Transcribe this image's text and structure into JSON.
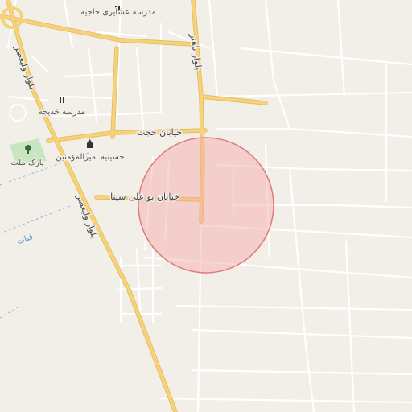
{
  "map": {
    "roads": {
      "vali_asr": "بلوار ولیعصر",
      "bahonar": "بلوار باهنر",
      "hojjat": "خیابان حجت",
      "bu_ali_sina": "خیابان بو علی سینا"
    },
    "pois": {
      "school_hajiyeh": "مدرسه عشایری حاجیه",
      "school_khadijeh": "مدرسه خدیجه",
      "hosseiniyeh": "حسینیه امیرالمؤمنین",
      "park": "پارک ملت"
    },
    "water": {
      "qanat": "قنات"
    },
    "colors": {
      "background": "#f2efe9",
      "primary_road": "#f6d37a",
      "minor_road": "#ffffff",
      "park": "#c8e6c2",
      "highlight_fill": "#f4a6a6",
      "highlight_stroke": "#e07b7b",
      "water": "#8fb5dd"
    },
    "icons": [
      "school-icon",
      "school-icon",
      "mosque-icon",
      "tree-icon"
    ]
  }
}
